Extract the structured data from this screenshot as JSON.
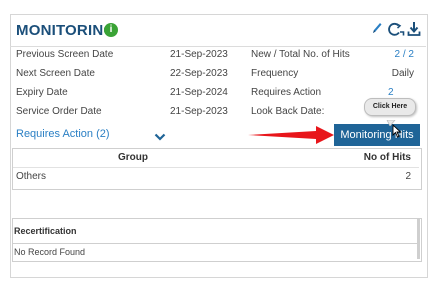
{
  "header": {
    "title": "MONITORING",
    "info_glyph": "i",
    "icons": [
      "edit-icon",
      "link-sync-icon",
      "download-icon"
    ]
  },
  "details": {
    "left": [
      {
        "label": "Previous Screen Date",
        "value": "21-Sep-2023"
      },
      {
        "label": "Next Screen Date",
        "value": "22-Sep-2023"
      },
      {
        "label": "Expiry Date",
        "value": "21-Sep-2024"
      },
      {
        "label": "Service Order Date",
        "value": "21-Sep-2023"
      }
    ],
    "right": [
      {
        "label": "New / Total No. of Hits",
        "value": "2 / 2"
      },
      {
        "label": "Frequency",
        "value": "Daily"
      },
      {
        "label": "Requires Action",
        "value": "2"
      },
      {
        "label": "Look Back Date:",
        "value": ""
      }
    ]
  },
  "requires_action": {
    "label": "Requires Action (2)"
  },
  "monitoring_button": {
    "label": "Monitoring Hits"
  },
  "tooltip": {
    "label": "Click Here"
  },
  "hits_table": {
    "headers": [
      "Group",
      "No of Hits"
    ],
    "rows": [
      {
        "group": "Others",
        "hits": "2"
      }
    ]
  },
  "recertification": {
    "title": "Recertification",
    "empty_text": "No Record Found"
  },
  "colors": {
    "title": "#1b4f7a",
    "link": "#2a7fc4",
    "button": "#1f6497",
    "info": "#3aa335",
    "arrow": "#e8161b"
  }
}
